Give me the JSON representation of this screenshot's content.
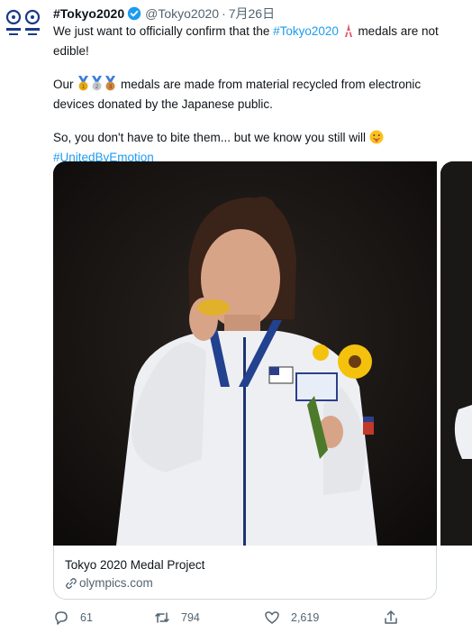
{
  "tweet": {
    "display_name": "#Tokyo2020",
    "handle": "@Tokyo2020",
    "separator": "·",
    "timestamp": "7月26日",
    "line1_pre": "We just want to officially confirm that the ",
    "line1_hashtag": "#Tokyo2020",
    "line1_post": " medals are not edible!",
    "line2_pre": "Our ",
    "line2_post": " medals are made from material recycled from electronic devices donated by the Japanese public.",
    "line3": "So, you don't have to bite them... but we know you still will ",
    "line4_hashtag": "#UnitedByEmotion"
  },
  "card": {
    "title": "Tokyo 2020 Medal Project",
    "domain": "olympics.com"
  },
  "actions": {
    "replies": "61",
    "retweets": "794",
    "likes": "2,619"
  },
  "colors": {
    "accent": "#1d9bf0",
    "text": "#0f1419",
    "secondary": "#536471",
    "border": "#cfd9de"
  },
  "icons": {
    "avatar": "tokyo2020-emblem-icon",
    "verified": "verified-badge-icon",
    "tower": "tokyo-tower-emoji",
    "medals": [
      "gold-medal-emoji",
      "silver-medal-emoji",
      "bronze-medal-emoji"
    ],
    "tongue": "tongue-out-emoji",
    "link": "link-icon",
    "reply": "reply-icon",
    "retweet": "retweet-icon",
    "like": "heart-icon",
    "share": "share-icon"
  }
}
